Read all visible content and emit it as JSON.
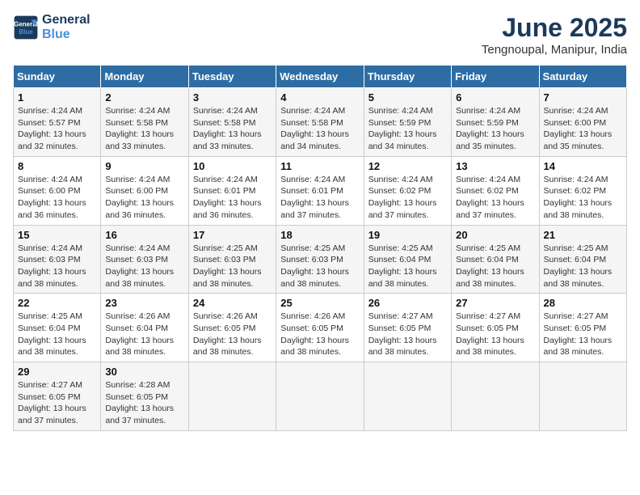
{
  "logo": {
    "line1": "General",
    "line2": "Blue"
  },
  "title": {
    "month": "June 2025",
    "location": "Tengnoupal, Manipur, India"
  },
  "weekdays": [
    "Sunday",
    "Monday",
    "Tuesday",
    "Wednesday",
    "Thursday",
    "Friday",
    "Saturday"
  ],
  "weeks": [
    [
      {
        "day": "1",
        "info": "Sunrise: 4:24 AM\nSunset: 5:57 PM\nDaylight: 13 hours\nand 32 minutes."
      },
      {
        "day": "2",
        "info": "Sunrise: 4:24 AM\nSunset: 5:58 PM\nDaylight: 13 hours\nand 33 minutes."
      },
      {
        "day": "3",
        "info": "Sunrise: 4:24 AM\nSunset: 5:58 PM\nDaylight: 13 hours\nand 33 minutes."
      },
      {
        "day": "4",
        "info": "Sunrise: 4:24 AM\nSunset: 5:58 PM\nDaylight: 13 hours\nand 34 minutes."
      },
      {
        "day": "5",
        "info": "Sunrise: 4:24 AM\nSunset: 5:59 PM\nDaylight: 13 hours\nand 34 minutes."
      },
      {
        "day": "6",
        "info": "Sunrise: 4:24 AM\nSunset: 5:59 PM\nDaylight: 13 hours\nand 35 minutes."
      },
      {
        "day": "7",
        "info": "Sunrise: 4:24 AM\nSunset: 6:00 PM\nDaylight: 13 hours\nand 35 minutes."
      }
    ],
    [
      {
        "day": "8",
        "info": "Sunrise: 4:24 AM\nSunset: 6:00 PM\nDaylight: 13 hours\nand 36 minutes."
      },
      {
        "day": "9",
        "info": "Sunrise: 4:24 AM\nSunset: 6:00 PM\nDaylight: 13 hours\nand 36 minutes."
      },
      {
        "day": "10",
        "info": "Sunrise: 4:24 AM\nSunset: 6:01 PM\nDaylight: 13 hours\nand 36 minutes."
      },
      {
        "day": "11",
        "info": "Sunrise: 4:24 AM\nSunset: 6:01 PM\nDaylight: 13 hours\nand 37 minutes."
      },
      {
        "day": "12",
        "info": "Sunrise: 4:24 AM\nSunset: 6:02 PM\nDaylight: 13 hours\nand 37 minutes."
      },
      {
        "day": "13",
        "info": "Sunrise: 4:24 AM\nSunset: 6:02 PM\nDaylight: 13 hours\nand 37 minutes."
      },
      {
        "day": "14",
        "info": "Sunrise: 4:24 AM\nSunset: 6:02 PM\nDaylight: 13 hours\nand 38 minutes."
      }
    ],
    [
      {
        "day": "15",
        "info": "Sunrise: 4:24 AM\nSunset: 6:03 PM\nDaylight: 13 hours\nand 38 minutes."
      },
      {
        "day": "16",
        "info": "Sunrise: 4:24 AM\nSunset: 6:03 PM\nDaylight: 13 hours\nand 38 minutes."
      },
      {
        "day": "17",
        "info": "Sunrise: 4:25 AM\nSunset: 6:03 PM\nDaylight: 13 hours\nand 38 minutes."
      },
      {
        "day": "18",
        "info": "Sunrise: 4:25 AM\nSunset: 6:03 PM\nDaylight: 13 hours\nand 38 minutes."
      },
      {
        "day": "19",
        "info": "Sunrise: 4:25 AM\nSunset: 6:04 PM\nDaylight: 13 hours\nand 38 minutes."
      },
      {
        "day": "20",
        "info": "Sunrise: 4:25 AM\nSunset: 6:04 PM\nDaylight: 13 hours\nand 38 minutes."
      },
      {
        "day": "21",
        "info": "Sunrise: 4:25 AM\nSunset: 6:04 PM\nDaylight: 13 hours\nand 38 minutes."
      }
    ],
    [
      {
        "day": "22",
        "info": "Sunrise: 4:25 AM\nSunset: 6:04 PM\nDaylight: 13 hours\nand 38 minutes."
      },
      {
        "day": "23",
        "info": "Sunrise: 4:26 AM\nSunset: 6:04 PM\nDaylight: 13 hours\nand 38 minutes."
      },
      {
        "day": "24",
        "info": "Sunrise: 4:26 AM\nSunset: 6:05 PM\nDaylight: 13 hours\nand 38 minutes."
      },
      {
        "day": "25",
        "info": "Sunrise: 4:26 AM\nSunset: 6:05 PM\nDaylight: 13 hours\nand 38 minutes."
      },
      {
        "day": "26",
        "info": "Sunrise: 4:27 AM\nSunset: 6:05 PM\nDaylight: 13 hours\nand 38 minutes."
      },
      {
        "day": "27",
        "info": "Sunrise: 4:27 AM\nSunset: 6:05 PM\nDaylight: 13 hours\nand 38 minutes."
      },
      {
        "day": "28",
        "info": "Sunrise: 4:27 AM\nSunset: 6:05 PM\nDaylight: 13 hours\nand 38 minutes."
      }
    ],
    [
      {
        "day": "29",
        "info": "Sunrise: 4:27 AM\nSunset: 6:05 PM\nDaylight: 13 hours\nand 37 minutes."
      },
      {
        "day": "30",
        "info": "Sunrise: 4:28 AM\nSunset: 6:05 PM\nDaylight: 13 hours\nand 37 minutes."
      },
      {
        "day": "",
        "info": ""
      },
      {
        "day": "",
        "info": ""
      },
      {
        "day": "",
        "info": ""
      },
      {
        "day": "",
        "info": ""
      },
      {
        "day": "",
        "info": ""
      }
    ]
  ]
}
